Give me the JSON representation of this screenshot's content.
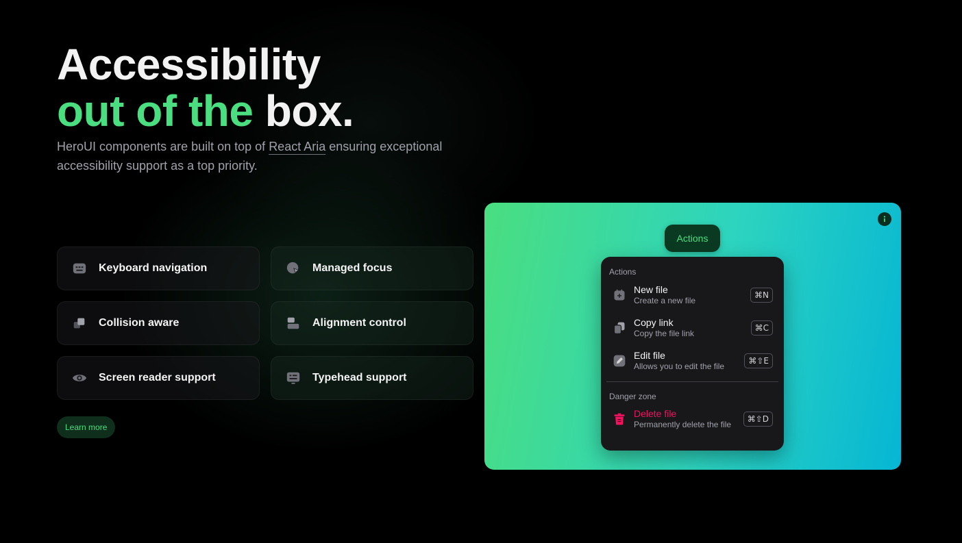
{
  "hero": {
    "title_line1": "Accessibility",
    "title_line2_green": "out of the",
    "title_line2_white": "box.",
    "subtitle_before": "HeroUI components are built on top of ",
    "subtitle_link": "React Aria",
    "subtitle_after": " ensuring exceptional accessibility support as a top priority."
  },
  "features": [
    {
      "label": "Keyboard navigation",
      "icon": "keyboard-icon"
    },
    {
      "label": "Managed focus",
      "icon": "focus-icon"
    },
    {
      "label": "Collision aware",
      "icon": "collision-icon"
    },
    {
      "label": "Alignment control",
      "icon": "alignment-icon"
    },
    {
      "label": "Screen reader support",
      "icon": "eye-icon"
    },
    {
      "label": "Typehead support",
      "icon": "typehead-icon"
    }
  ],
  "learn_more": "Learn more",
  "demo": {
    "trigger_label": "Actions",
    "section_actions": "Actions",
    "items": [
      {
        "title": "New file",
        "desc": "Create a new file",
        "shortcut": "⌘N",
        "icon": "new-file-icon"
      },
      {
        "title": "Copy link",
        "desc": "Copy the file link",
        "shortcut": "⌘C",
        "icon": "copy-icon"
      },
      {
        "title": "Edit file",
        "desc": "Allows you to edit the file",
        "shortcut": "⌘⇧E",
        "icon": "edit-icon"
      }
    ],
    "section_danger": "Danger zone",
    "danger_item": {
      "title": "Delete file",
      "desc": "Permanently delete the file",
      "shortcut": "⌘⇧D",
      "icon": "trash-icon"
    }
  },
  "colors": {
    "accent_green": "#4ade80",
    "danger": "#f31260",
    "gradient_start": "#4ade80",
    "gradient_end": "#06b6d4"
  }
}
